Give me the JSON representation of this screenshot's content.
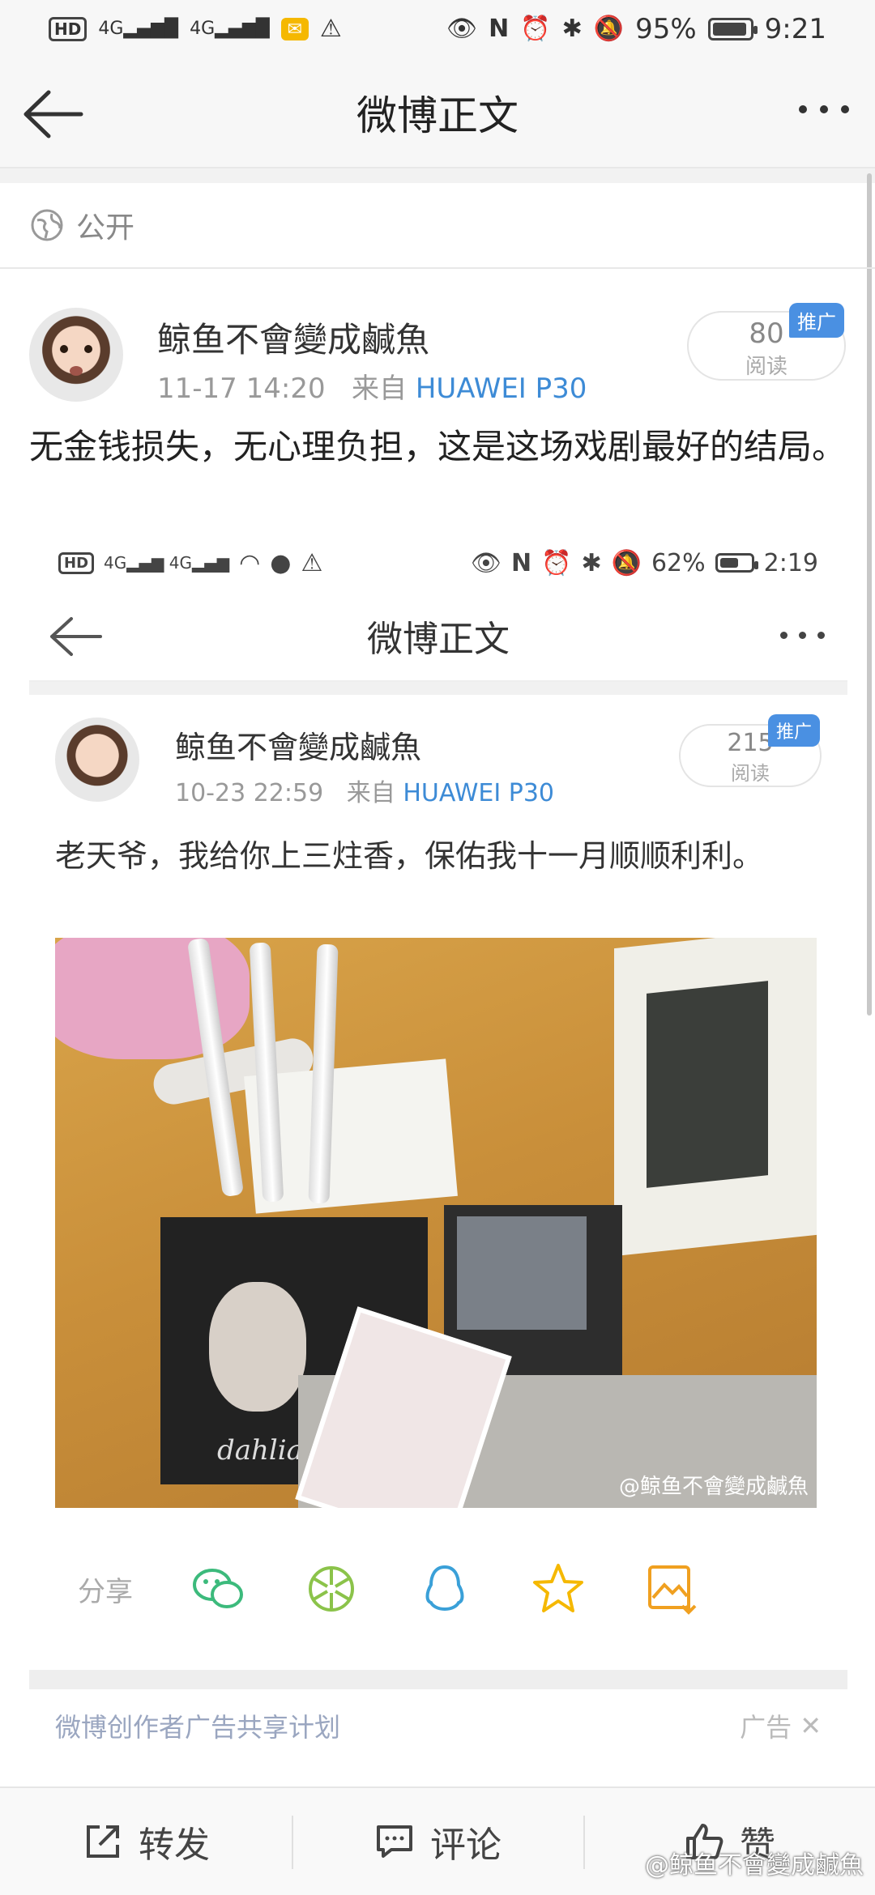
{
  "status_bar": {
    "hd": "HD",
    "signal1": "4G",
    "signal2": "4G",
    "battery": "95%",
    "battery_level": 0.95,
    "time": "9:21"
  },
  "nav": {
    "title": "微博正文"
  },
  "visibility": {
    "label": "公开"
  },
  "post": {
    "username": "鲸鱼不會變成鹹魚",
    "date": "11-17 14:20",
    "source_prefix": "来自",
    "source": "HUAWEI P30",
    "read_count": "80",
    "read_label": "阅读",
    "promo": "推广",
    "text": "无金钱损失，无心理负担，这是这场戏剧最好的结局。"
  },
  "embedded": {
    "status_bar": {
      "battery": "62%",
      "time": "2:19"
    },
    "nav_title": "微博正文",
    "username": "鲸鱼不會變成鹹魚",
    "date": "10-23 22:59",
    "source_prefix": "来自",
    "source": "HUAWEI P30",
    "read_count": "215",
    "read_label": "阅读",
    "promo": "推广",
    "text": "老天爷，我给你上三炷香，保佑我十一月顺顺利利。",
    "photo_brand": "dahlia",
    "photo_watermark": "@鲸鱼不會變成鹹魚",
    "share_label": "分享",
    "ad_title": "微博创作者广告共享计划",
    "ad_tag": "广告"
  },
  "bottom_bar": {
    "repost": "转发",
    "comment": "评论",
    "like": "赞"
  },
  "watermark": "@鲸鱼不會變成鹹魚",
  "colors": {
    "link": "#3d8bd6",
    "promo": "#4a90e2"
  }
}
